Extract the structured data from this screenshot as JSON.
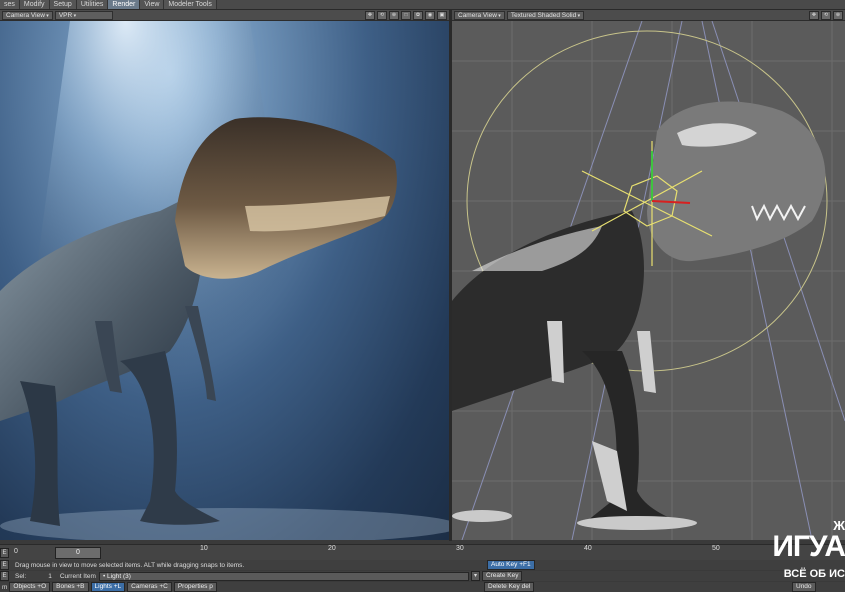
{
  "menubar": {
    "tabs": [
      "ses",
      "Modify",
      "Setup",
      "Utilities",
      "Render",
      "View",
      "Modeler Tools"
    ],
    "active_index": 4
  },
  "left_viewport": {
    "view_mode": "Camera View",
    "render_mode": "VPR"
  },
  "right_viewport": {
    "view_mode": "Camera View",
    "shading_mode": "Textured Shaded Solid"
  },
  "timeline": {
    "frame_left": "0",
    "current_frame": "0",
    "ticks": [
      "10",
      "20",
      "30",
      "40",
      "50"
    ]
  },
  "status": {
    "hint": "Drag mouse in view to move selected items. ALT while dragging snaps to items.",
    "auto_key": "Auto Key",
    "auto_key_shortcut": "+F1"
  },
  "item_row": {
    "sel_label": "Sel:",
    "sel_count": "1",
    "current_item_label": "Current Item",
    "current_item": "Light (3)",
    "create_key": "Create Key"
  },
  "bottom_row": {
    "prefix": "m",
    "buttons": [
      {
        "label": "Objects",
        "shortcut": "+O"
      },
      {
        "label": "Bones",
        "shortcut": "+B"
      },
      {
        "label": "Lights",
        "shortcut": "+L"
      },
      {
        "label": "Cameras",
        "shortcut": "+C"
      },
      {
        "label": "Properties",
        "shortcut": "p"
      }
    ],
    "active_index": 2,
    "delete_key": "Delete Key",
    "delete_key_shortcut": "del",
    "undo": "Undo"
  },
  "watermark": {
    "top": "ИГУА",
    "sub": "ВСЁ ОБ ИС",
    "corner": "Ж"
  },
  "colors": {
    "active_tab": "#6a7a8a",
    "active_button": "#3c6ea6",
    "watermark_red": "#c8141a"
  }
}
